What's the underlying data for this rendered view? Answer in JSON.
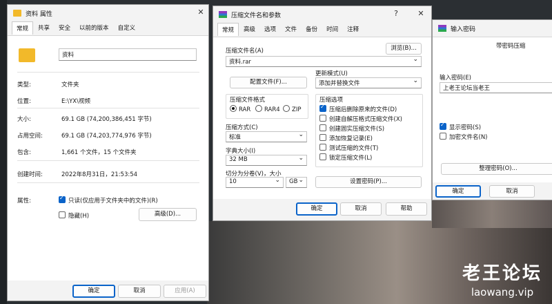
{
  "props": {
    "title": "资料 属性",
    "tabs": [
      "常规",
      "共享",
      "安全",
      "以前的版本",
      "自定义"
    ],
    "name": "资料",
    "rows": [
      {
        "k": "类型:",
        "v": "文件夹"
      },
      {
        "k": "位置:",
        "v": "E:\\YX\\视频"
      },
      {
        "k": "大小:",
        "v": "69.1 GB (74,200,386,451 字节)"
      },
      {
        "k": "占用空间:",
        "v": "69.1 GB (74,203,774,976 字节)"
      },
      {
        "k": "包含:",
        "v": "1,661 个文件，15 个文件夹"
      },
      {
        "k": "创建时间:",
        "v": "2022年8月31日，21:53:54"
      }
    ],
    "attr_label": "属性:",
    "readonly": "只读(仅应用于文件夹中的文件)(R)",
    "hidden": "隐藏(H)",
    "advanced": "高级(D)...",
    "ok": "确定",
    "cancel": "取消",
    "apply": "应用(A)"
  },
  "archive": {
    "title": "压缩文件名和参数",
    "help_mark": "?",
    "tabs": [
      "常规",
      "高级",
      "选项",
      "文件",
      "备份",
      "时间",
      "注释"
    ],
    "name_label": "压缩文件名(A)",
    "browse": "浏览(B)...",
    "name_value": "资料.rar",
    "profile": "配置文件(F)...",
    "update_label": "更新模式(U)",
    "update_value": "添加并替换文件",
    "format_label": "压缩文件格式",
    "formats": [
      "RAR",
      "RAR4",
      "ZIP"
    ],
    "method_label": "压缩方式(C)",
    "method_value": "标准",
    "dict_label": "字典大小(I)",
    "dict_value": "32 MB",
    "split_label": "切分为分卷(V)，大小",
    "split_value": "10",
    "split_unit": "GB",
    "options_label": "压缩选项",
    "options": [
      {
        "text": "压缩后删除原来的文件(D)",
        "on": true
      },
      {
        "text": "创建自解压格式压缩文件(X)",
        "on": false
      },
      {
        "text": "创建固实压缩文件(S)",
        "on": false
      },
      {
        "text": "添加恢复记录(E)",
        "on": false
      },
      {
        "text": "测试压缩的文件(T)",
        "on": false
      },
      {
        "text": "锁定压缩文件(L)",
        "on": false
      }
    ],
    "set_password": "设置密码(P)...",
    "ok": "确定",
    "cancel": "取消",
    "help": "帮助"
  },
  "password": {
    "title": "输入密码",
    "heading": "带密码压缩",
    "enter_label": "输入密码(E)",
    "value": "上老王论坛当老王",
    "show": "显示密码(S)",
    "encrypt_names": "加密文件名(N)",
    "organize": "整理密码(O)...",
    "ok": "确定",
    "cancel": "取消"
  },
  "watermark": {
    "title": "老王论坛",
    "url": "laowang.vip"
  }
}
